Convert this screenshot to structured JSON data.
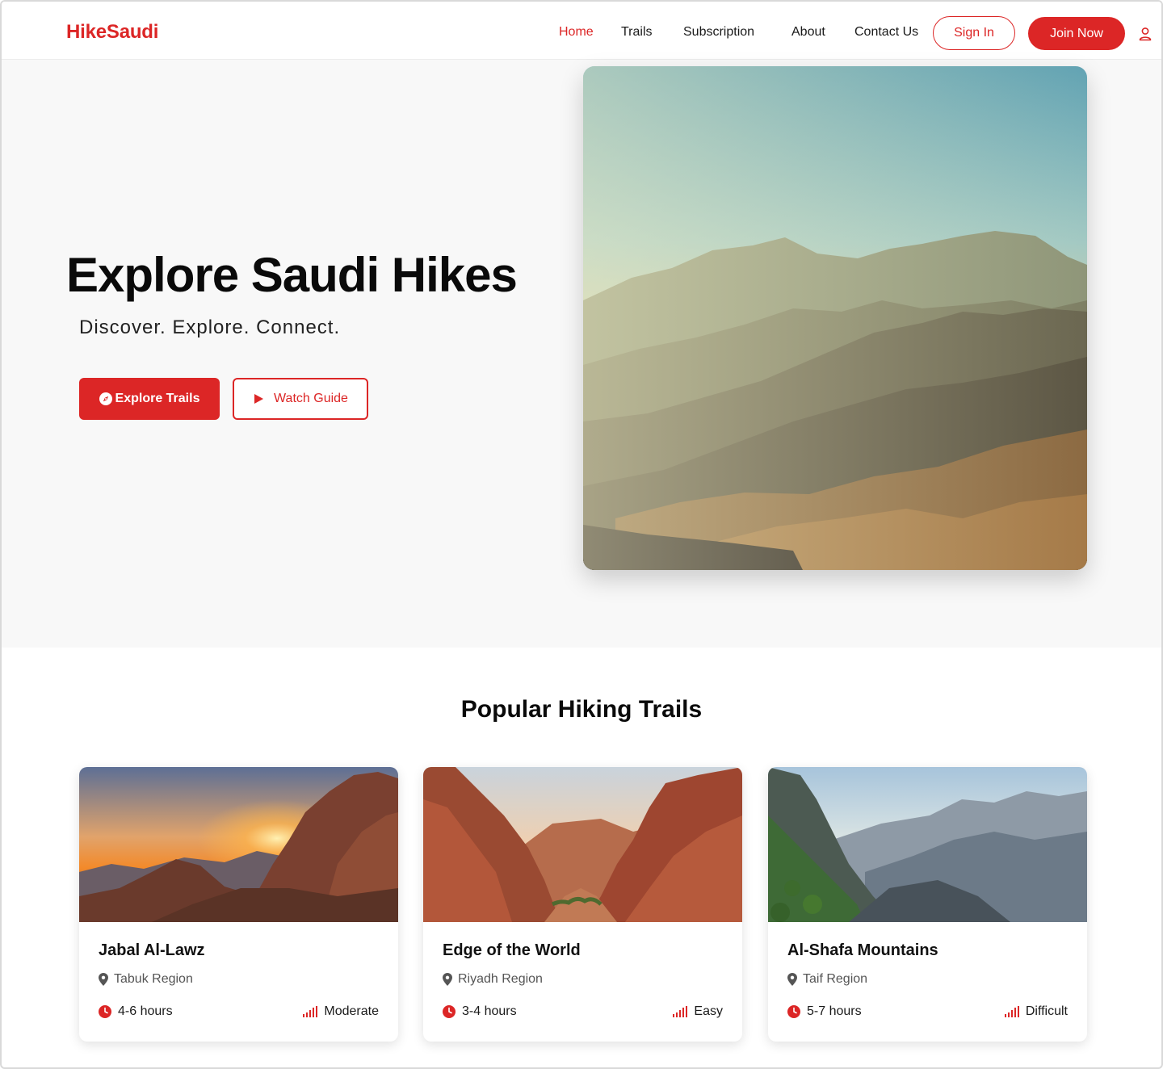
{
  "brand": {
    "logo": "HikeSaudi",
    "accent": "#dc2626"
  },
  "nav": {
    "links": [
      {
        "label": "Home",
        "active": true
      },
      {
        "label": "Trails",
        "active": false
      },
      {
        "label": "Subscription",
        "active": false
      },
      {
        "label": "About",
        "active": false
      },
      {
        "label": "Contact Us",
        "active": false
      }
    ],
    "sign_in": "Sign In",
    "join_now": "Join Now",
    "user_icon": "user-icon"
  },
  "hero": {
    "title": "Explore Saudi Hikes",
    "subtitle": "Discover. Explore. Connect.",
    "primary_button": "Explore Trails",
    "primary_icon": "compass-icon",
    "secondary_button": "Watch Guide",
    "secondary_icon": "play-icon"
  },
  "trails": {
    "title": "Popular Hiking Trails",
    "items": [
      {
        "name": "Jabal Al-Lawz",
        "region": "Tabuk Region",
        "duration": "4-6 hours",
        "difficulty": "Moderate"
      },
      {
        "name": "Edge of the World",
        "region": "Riyadh Region",
        "duration": "3-4 hours",
        "difficulty": "Easy"
      },
      {
        "name": "Al-Shafa Mountains",
        "region": "Taif Region",
        "duration": "5-7 hours",
        "difficulty": "Difficult"
      }
    ]
  }
}
